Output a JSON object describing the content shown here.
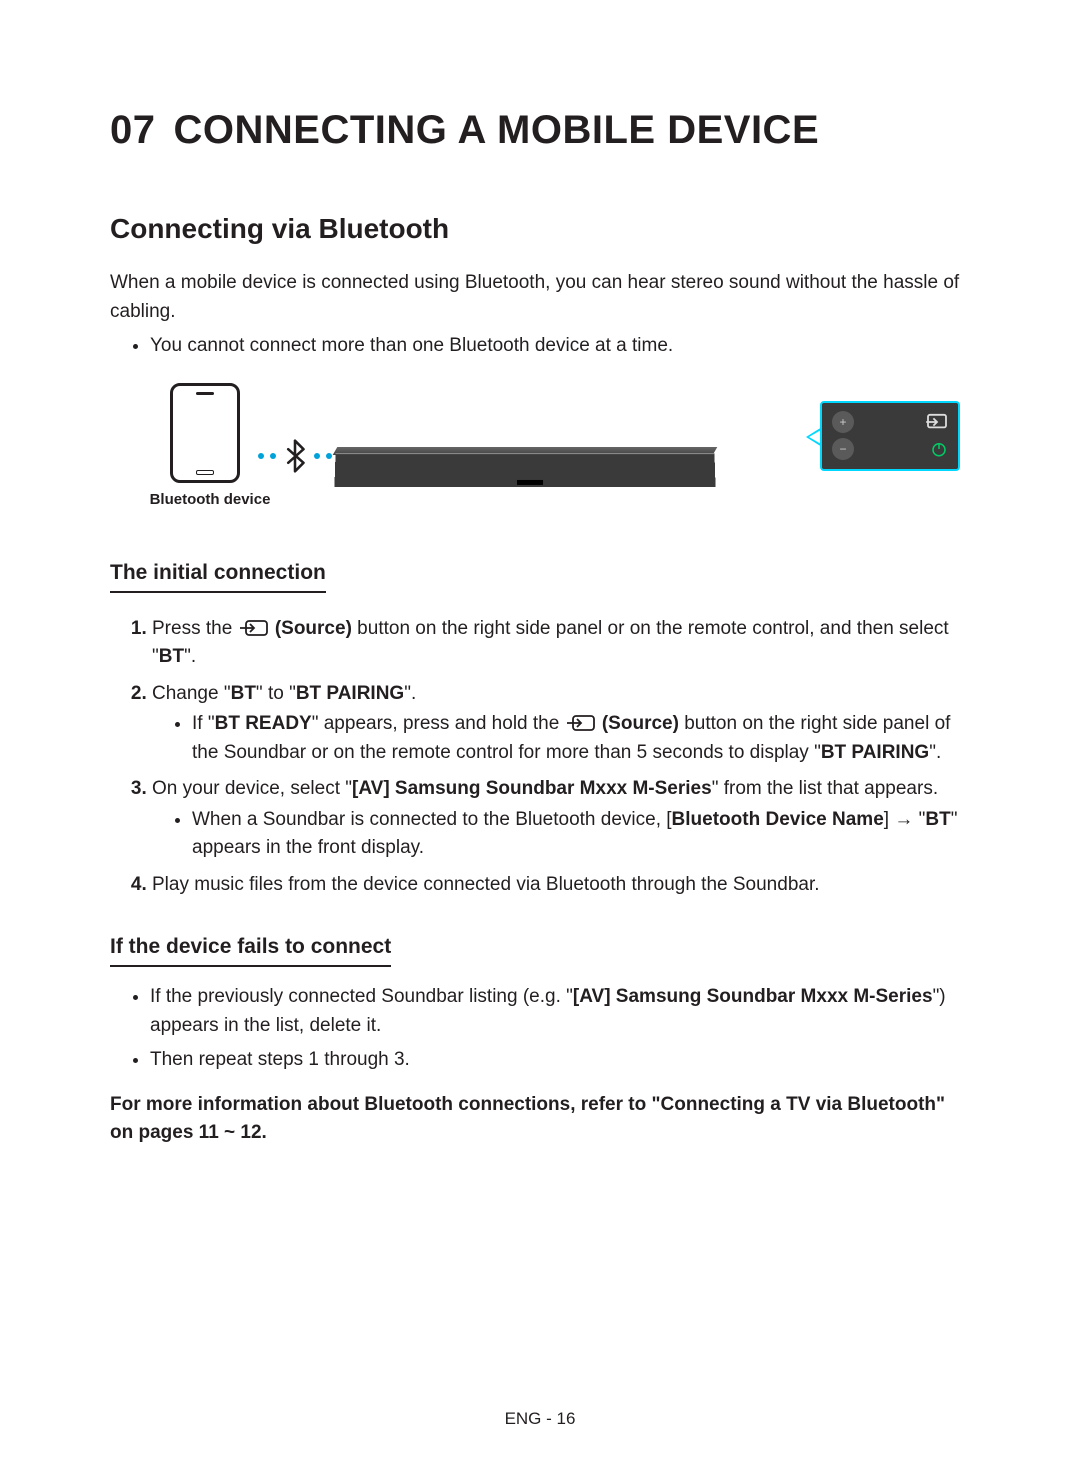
{
  "chapter": {
    "num": "07",
    "title": "CONNECTING A MOBILE DEVICE"
  },
  "section": {
    "title": "Connecting via Bluetooth"
  },
  "intro": "When a mobile device is connected using Bluetooth, you can hear stereo sound without the hassle of cabling.",
  "intro_bullet": "You cannot connect more than one Bluetooth device at a time.",
  "diagram": {
    "phone_label": "Bluetooth device"
  },
  "initial": {
    "heading": "The initial connection",
    "step1_a": "Press the ",
    "step1_source": " (Source)",
    "step1_b": " button on the right side panel or on the remote control, and then select \"",
    "step1_bt": "BT",
    "step1_c": "\".",
    "step2_a": "Change \"",
    "step2_bt": "BT",
    "step2_b": "\" to \"",
    "step2_pair": "BT PAIRING",
    "step2_c": "\".",
    "step2_sub_a": "If \"",
    "step2_sub_ready": "BT READY",
    "step2_sub_b": "\" appears, press and hold the ",
    "step2_sub_source": " (Source)",
    "step2_sub_c": " button on the right side panel of the Soundbar or on the remote control for more than 5 seconds to display \"",
    "step2_sub_pair": "BT PAIRING",
    "step2_sub_d": "\".",
    "step3_a": "On your device, select \"",
    "step3_dev": "[AV] Samsung Soundbar Mxxx M-Series",
    "step3_b": "\" from the list that appears.",
    "step3_sub_a": "When a Soundbar is connected to the Bluetooth device, [",
    "step3_sub_name": "Bluetooth Device Name",
    "step3_sub_b": "] → \"",
    "step3_sub_bt": "BT",
    "step3_sub_c": "\" appears in the front display.",
    "step4": "Play music files from the device connected via Bluetooth through the Soundbar."
  },
  "fail": {
    "heading": "If the device fails to connect",
    "b1_a": "If the previously connected Soundbar listing (e.g. \"",
    "b1_dev": "[AV] Samsung Soundbar Mxxx M-Series",
    "b1_b": "\") appears in the list, delete it.",
    "b2": "Then repeat steps 1 through 3."
  },
  "more_info": "For more information about Bluetooth connections, refer to \"Connecting a TV via Bluetooth\" on pages 11 ~ 12.",
  "footer": "ENG - 16"
}
